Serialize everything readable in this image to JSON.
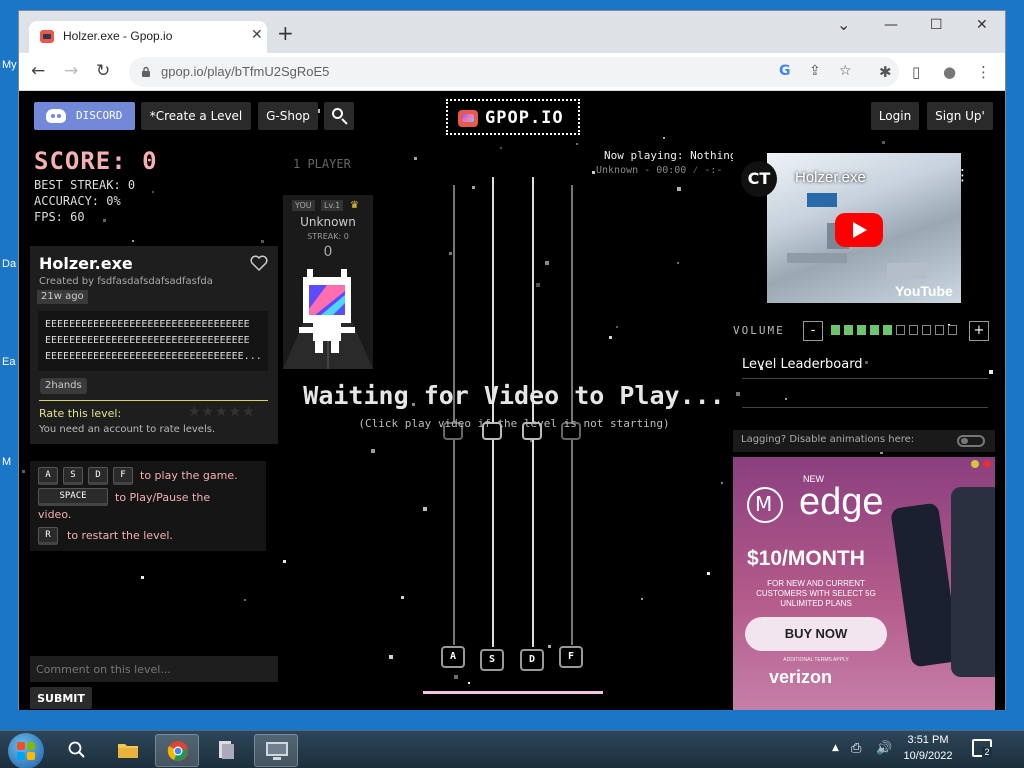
{
  "desktop": {
    "side_labels": [
      "My",
      "Da",
      "Ea",
      "M"
    ]
  },
  "browser": {
    "tab_title": "Holzer.exe - Gpop.io",
    "tab_close": "✕",
    "new_tab": "+",
    "win_controls": {
      "minimize": "—",
      "maximize": "☐",
      "close": "✕",
      "chevron": "⌄"
    },
    "url": "gpop.io/play/bTfmU2SgRoE5",
    "nav": {
      "back": "←",
      "forward": "→",
      "reload": "↻"
    },
    "omni_icons": {
      "google": "G",
      "share": "⇪",
      "bookmark": "☆"
    },
    "toolbar_icons": {
      "extensions": "✱",
      "sidepanel": "▯",
      "profile": "●",
      "menu": "⋮"
    }
  },
  "header": {
    "discord_label": "DISCORD",
    "create_label": "*Create a Level",
    "shop_label": "G-Shop",
    "logo_text": "GPOP.IO",
    "login_label": "Login",
    "signup_label": "Sign Up'"
  },
  "stats": {
    "score": "SCORE: 0",
    "best_streak": "BEST STREAK: 0",
    "accuracy": "ACCURACY: 0%",
    "fps": "FPS: 60"
  },
  "level": {
    "title": "Holzer.exe",
    "created_by": "Created by fsdfasdafsdafsadfasfda",
    "age": "21w ago",
    "description_lines": [
      "EEEEEEEEEEEEEEEEEEEEEEEEEEEEEEEEEE",
      "EEEEEEEEEEEEEEEEEEEEEEEEEEEEEEEEEE",
      "EEEEEEEEEEEEEEEEEEEEEEEEEEEEEEEEE..."
    ],
    "tag": "2hands",
    "rate_label": "Rate this level:",
    "stars": "★★★★★",
    "need_account": "You need an account to rate levels."
  },
  "help": {
    "keys": [
      "A",
      "S",
      "D",
      "F"
    ],
    "play_text": "to play the game.",
    "space_key": "SPACE",
    "pause_text_1": "to Play/Pause the",
    "pause_text_2": "video.",
    "restart_key": "R",
    "restart_text": "to restart the level."
  },
  "comment": {
    "placeholder": "Comment on this level...",
    "submit_label": "SUBMIT"
  },
  "players": {
    "label": "1 PLAYER",
    "you": "YOU",
    "level": "Lv.1",
    "crown": "♛",
    "name": "Unknown",
    "streak": "STREAK: 0",
    "score": "0"
  },
  "now_playing": {
    "line1": "Now playing: Nothing",
    "line2": "Unknown - 00:00 ⁄ -:-"
  },
  "lanes": {
    "keys": [
      "A",
      "S",
      "D",
      "F"
    ],
    "waiting": "Waiting for Video to Play...",
    "waiting_sub": "(Click play video if the level is not starting)"
  },
  "video": {
    "channel_initials": "CT",
    "title": "Holzer.exe",
    "more": "⋮",
    "brand": "YouTube"
  },
  "volume": {
    "label": "VOLUME",
    "minus": "-",
    "plus": "+",
    "level": 5,
    "segments": 10
  },
  "leaderboard": {
    "title": "Level Leaderboard"
  },
  "lag": {
    "text": "Lagging? Disable animations here:",
    "enabled": false
  },
  "ad": {
    "new": "NEW",
    "product": "edge",
    "price": "$10/MONTH",
    "line1": "FOR NEW AND CURRENT",
    "line2": "CUSTOMERS WITH SELECT 5G",
    "line3": "UNLIMITED PLANS",
    "cta": "BUY NOW",
    "fine": "ADDITIONAL TERMS APPLY",
    "carrier": "verizon",
    "dot_colors": [
      "#d4c63b",
      "#e0303c"
    ]
  },
  "taskbar": {
    "time": "3:51 PM",
    "date": "10/9/2022",
    "notif_count": "2",
    "tray_up": "▲",
    "tray_net": "⎙",
    "tray_vol": "🔊"
  },
  "colors": {
    "accent_pink": "#f5b1b1",
    "discord": "#7289da",
    "volume_on": "#6dc56d"
  }
}
